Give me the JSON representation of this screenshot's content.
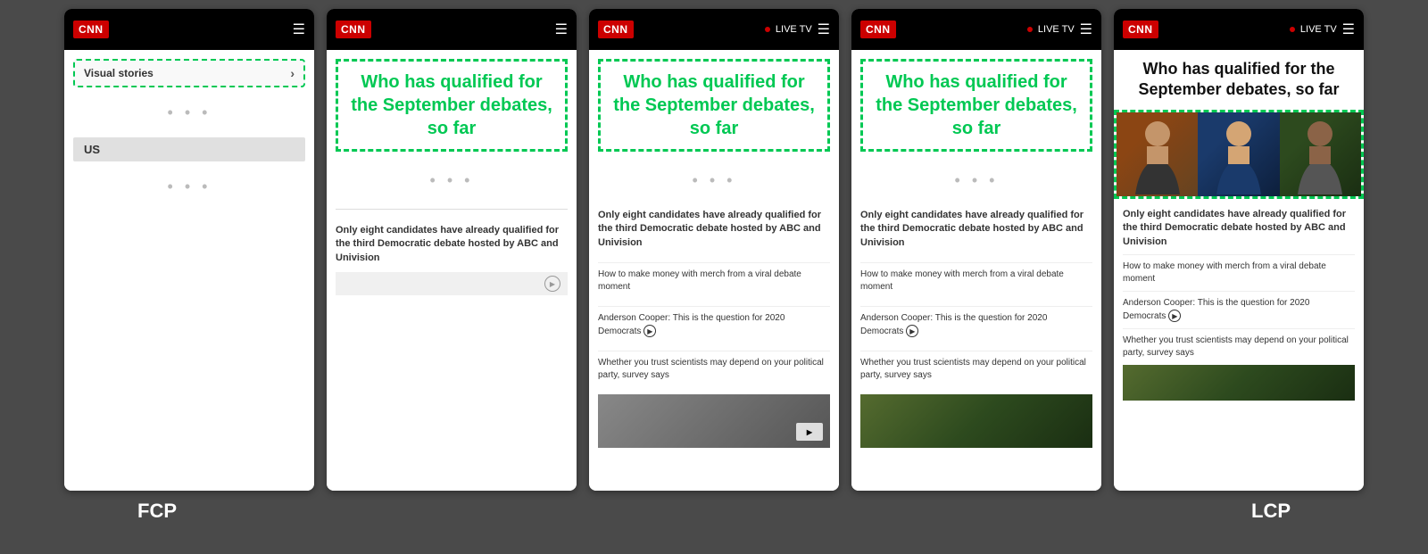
{
  "labels": {
    "fcp": "FCP",
    "lcp": "LCP"
  },
  "panel1": {
    "logo": "CNN",
    "menu_icon": "☰",
    "visual_stories": "Visual stories",
    "dots1": "• • •",
    "us_tag": "US",
    "dots2": "• • •"
  },
  "panel2": {
    "logo": "CNN",
    "menu_icon": "☰",
    "headline": "Who has qualified for the September debates, so far",
    "summary": "Only eight candidates have already qualified for the third Democratic debate hosted by ABC and Univision",
    "dots": "• • •"
  },
  "panel3": {
    "logo": "CNN",
    "live_label": "LIVE TV",
    "menu_icon": "☰",
    "headline": "Who has qualified for the September debates, so far",
    "summary": "Only eight candidates have already qualified for the third Democratic debate hosted by ABC and Univision",
    "link1": "How to make money with merch from a viral debate moment",
    "link2": "Anderson Cooper: This is the question for 2020 Democrats",
    "link3": "Whether you trust scientists may depend on your political party, survey says",
    "dots": "• • •"
  },
  "panel4": {
    "logo": "CNN",
    "live_label": "LIVE TV",
    "menu_icon": "☰",
    "headline": "Who has qualified for the September debates, so far",
    "summary": "Only eight candidates have already qualified for the third Democratic debate hosted by ABC and Univision",
    "link1": "How to make money with merch from a viral debate moment",
    "link2": "Anderson Cooper: This is the question for 2020 Democrats",
    "link3": "Whether you trust scientists may depend on your political party, survey says",
    "dots": "• • •"
  },
  "panel5": {
    "logo": "CNN",
    "live_label": "LIVE TV",
    "menu_icon": "☰",
    "headline": "Who has qualified for the September debates, so far",
    "summary": "Only eight candidates have already qualified for the third Democratic debate hosted by ABC and Univision",
    "link1": "How to make money with merch from a viral debate moment",
    "link2": "Anderson Cooper: This is the question for 2020 Democrats",
    "link3": "Whether you trust scientists may depend on your political party, survey says"
  }
}
